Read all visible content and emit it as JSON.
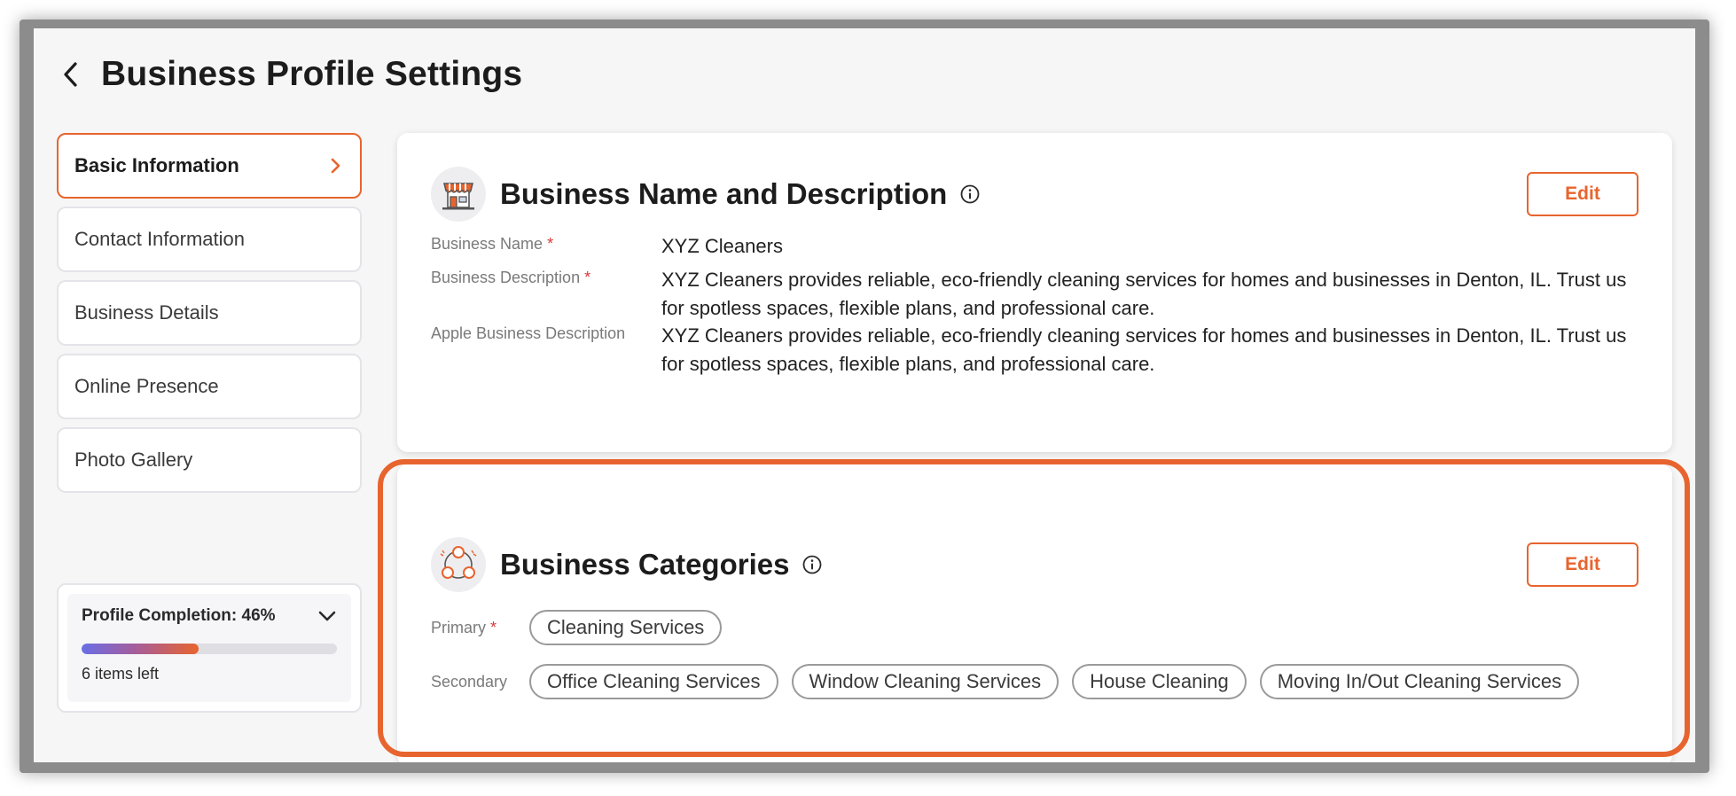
{
  "header": {
    "title": "Business Profile Settings"
  },
  "sidebar": {
    "items": [
      {
        "label": "Basic Information"
      },
      {
        "label": "Contact Information"
      },
      {
        "label": "Business Details"
      },
      {
        "label": "Online Presence"
      },
      {
        "label": "Photo Gallery"
      }
    ],
    "active_index": 0
  },
  "profile_completion": {
    "label": "Profile Completion: 46%",
    "percent": 46,
    "items_left": "6 items left"
  },
  "business_name_card": {
    "title": "Business Name and Description",
    "edit_label": "Edit",
    "fields": [
      {
        "label": "Business Name",
        "required": true,
        "value": "XYZ Cleaners"
      },
      {
        "label": "Business Description",
        "required": true,
        "value": "XYZ Cleaners provides reliable, eco-friendly cleaning services for homes and businesses in Denton, IL. Trust us for spotless spaces, flexible plans, and professional care."
      },
      {
        "label": "Apple Business Description",
        "required": false,
        "value": "XYZ Cleaners provides reliable, eco-friendly cleaning services for homes and businesses in Denton, IL. Trust us for spotless spaces, flexible plans, and professional care."
      }
    ]
  },
  "categories_card": {
    "title": "Business Categories",
    "edit_label": "Edit",
    "primary_label": "Primary",
    "primary": [
      "Cleaning Services"
    ],
    "secondary_label": "Secondary",
    "secondary": [
      "Office Cleaning Services",
      "Window Cleaning Services",
      "House Cleaning",
      "Moving In/Out Cleaning Services"
    ]
  },
  "required_marker": "*",
  "colors": {
    "accent": "#e8642e",
    "required": "#d83a3a",
    "progress_start": "#6a6ee6"
  },
  "icons": [
    "chevron-left-icon",
    "chevron-right-icon",
    "chevron-down-icon",
    "storefront-icon",
    "info-icon",
    "category-network-icon"
  ]
}
